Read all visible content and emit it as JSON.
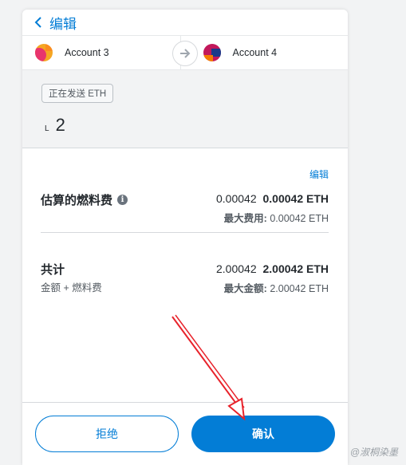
{
  "header": {
    "back_label": "编辑"
  },
  "accounts": {
    "from": "Account 3",
    "to": "Account 4"
  },
  "sending": {
    "badge": "正在发送 ETH",
    "symbol": "L",
    "amount": "2"
  },
  "gas": {
    "edit_label": "编辑",
    "label": "估算的燃料费",
    "value_light": "0.00042",
    "value_bold": "0.00042 ETH",
    "max_label": "最大费用:",
    "max_value": "0.00042 ETH"
  },
  "total": {
    "label": "共计",
    "desc": "金额 + 燃料费",
    "value_light": "2.00042",
    "value_bold": "2.00042 ETH",
    "max_label": "最大金额:",
    "max_value": "2.00042 ETH"
  },
  "footer": {
    "reject_label": "拒绝",
    "confirm_label": "确认"
  },
  "watermark": "@淑桐染墨",
  "colors": {
    "accent": "#037dd6",
    "annotation": "#e8232b"
  }
}
